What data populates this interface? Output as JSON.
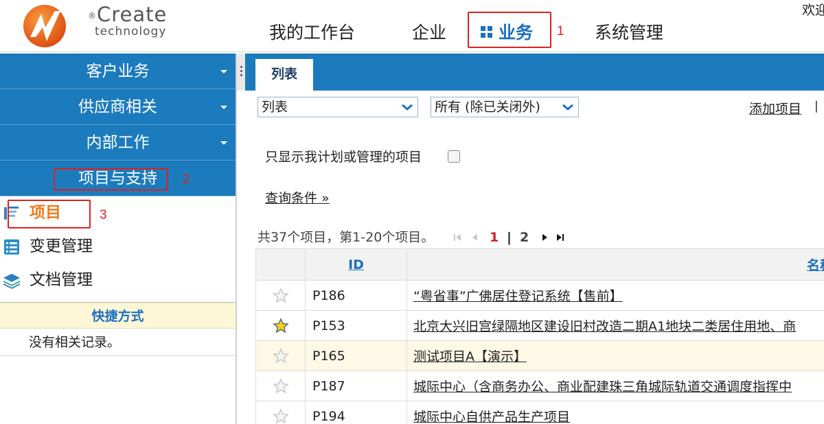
{
  "logo": {
    "brand": "Create",
    "reg": "®",
    "sub": "technology"
  },
  "nav": {
    "items": [
      "我的工作台",
      "企业",
      "业务",
      "系统管理"
    ],
    "active_index": 2,
    "welcome": "欢迎"
  },
  "annotations": [
    "1",
    "2",
    "3"
  ],
  "sidebar": {
    "categories": [
      "客户业务",
      "供应商相关",
      "内部工作",
      "项目与支持"
    ],
    "items": [
      {
        "label": "项目",
        "icon": "project-icon",
        "active": true
      },
      {
        "label": "变更管理",
        "icon": "change-management-icon",
        "active": false
      },
      {
        "label": "文档管理",
        "icon": "document-stack-icon",
        "active": false
      }
    ],
    "shortcut_title": "快捷方式",
    "shortcut_empty": "没有相关记录。"
  },
  "main": {
    "tab": "列表",
    "view_select": "列表",
    "status_select": "所有 (除已关闭外)",
    "add_link": "添加项目",
    "add_sep": "|",
    "filter_label": "只显示我计划或管理的项目",
    "query_link": "查询条件 »",
    "summary": "共37个项目，第1-20个项目。",
    "pager": {
      "current": "1",
      "sep": "|",
      "next_page": "2"
    },
    "table": {
      "headers": {
        "id": "ID",
        "name": "名称"
      },
      "rows": [
        {
          "starred": false,
          "id": "P186",
          "name": "“粤省事”广佛居住登记系统【售前】",
          "highlight": false
        },
        {
          "starred": true,
          "id": "P153",
          "name": "北京大兴旧宫绿隔地区建设旧村改造二期A1地块二类居住用地、商",
          "highlight": false
        },
        {
          "starred": false,
          "id": "P165",
          "name": "测试项目A【演示】",
          "highlight": true
        },
        {
          "starred": false,
          "id": "P187",
          "name": "城际中心（含商务办公、商业配建珠三角城际轨道交通调度指挥中",
          "highlight": false
        },
        {
          "starred": false,
          "id": "P194",
          "name": "城际中心自供产品生产项目",
          "highlight": false
        }
      ]
    }
  },
  "colors": {
    "brand_blue": "#1b7bbd",
    "active_orange": "#f07a1a",
    "annotation_red": "#e02020",
    "link_blue": "#1b6fc0",
    "shortcut_bg": "#fdf7d8",
    "star_yellow": "#f5d11a"
  }
}
